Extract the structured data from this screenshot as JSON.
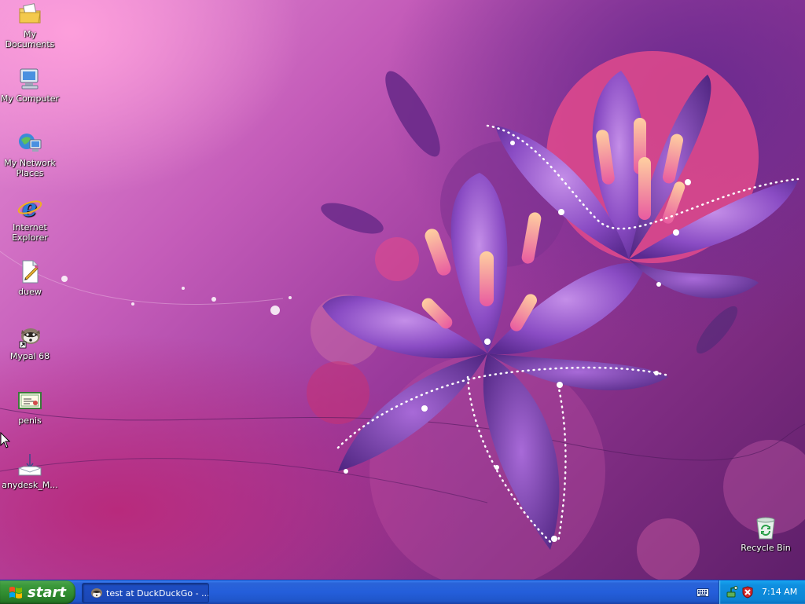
{
  "desktop": {
    "icons": [
      {
        "label": "My Documents",
        "icon": "folder-documents-icon"
      },
      {
        "label": "My Computer",
        "icon": "computer-icon"
      },
      {
        "label": "My Network Places",
        "icon": "network-places-icon"
      },
      {
        "label": "Internet Explorer",
        "icon": "internet-explorer-icon"
      },
      {
        "label": "duew",
        "icon": "document-shortcut-icon"
      },
      {
        "label": "Mypal 68",
        "icon": "mypal-browser-icon"
      },
      {
        "label": "penis",
        "icon": "certificate-icon"
      },
      {
        "label": "anydesk_M...",
        "icon": "download-file-icon"
      }
    ],
    "recycle_bin": {
      "label": "Recycle Bin",
      "icon": "recycle-bin-icon"
    }
  },
  "taskbar": {
    "start_label": "start",
    "tasks": [
      {
        "label": "test at DuckDuckGo - ...",
        "icon": "mypal-browser-icon"
      }
    ],
    "language_icon": "keyboard-icon",
    "tray": {
      "icons": [
        "safely-remove-hardware-icon",
        "security-alert-icon"
      ],
      "clock": "7:14 AM"
    }
  },
  "colors": {
    "taskbar_blue": "#245edb",
    "start_green": "#3c9a3c",
    "tray_blue": "#0c86d6",
    "wallpaper_purple": "#9a3a9c"
  }
}
